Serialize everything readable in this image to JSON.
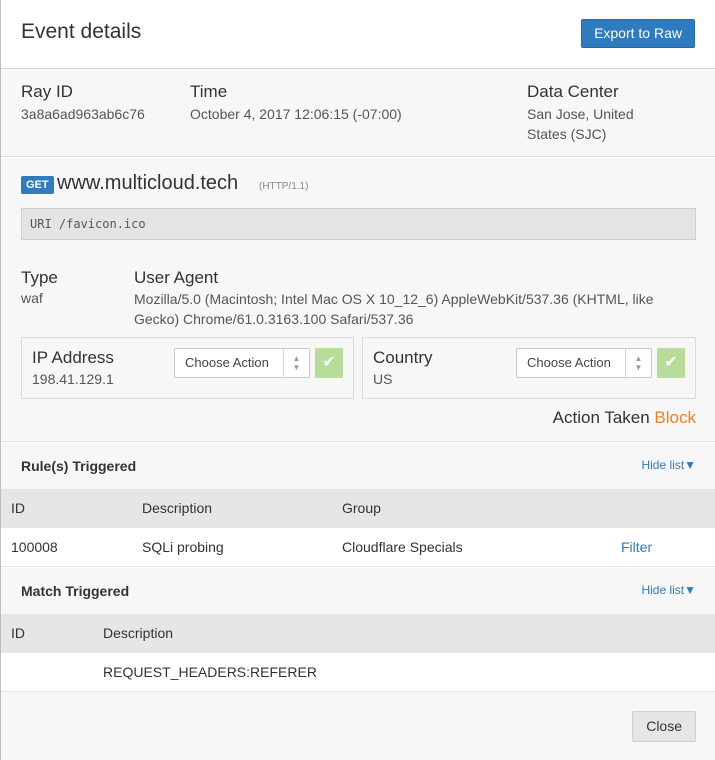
{
  "header": {
    "title": "Event details",
    "export_label": "Export to Raw"
  },
  "summary": {
    "ray_id_label": "Ray ID",
    "ray_id": "3a8a6ad963ab6c76",
    "time_label": "Time",
    "time": "October 4, 2017 12:06:15 (-07:00)",
    "dc_label": "Data Center",
    "dc_line1": "San Jose, United",
    "dc_line2": "States (SJC)"
  },
  "request": {
    "method": "GET",
    "host": "www.multicloud.tech",
    "protocol": "(HTTP/1.1)",
    "uri": "URI /favicon.ico",
    "type_label": "Type",
    "type": "waf",
    "ua_label": "User Agent",
    "ua": "Mozilla/5.0 (Macintosh; Intel Mac OS X 10_12_6) AppleWebKit/537.36 (KHTML, like Gecko) Chrome/61.0.3163.100 Safari/537.36",
    "ip_label": "IP Address",
    "ip": "198.41.129.1",
    "country_label": "Country",
    "country": "US",
    "choose_action": "Choose Action",
    "check_glyph": "✔",
    "action_taken_label": "Action Taken",
    "action_taken": "Block"
  },
  "rules": {
    "title": "Rule(s) Triggered",
    "hide_label": "Hide list▼",
    "columns": [
      "ID",
      "Description",
      "Group"
    ],
    "rows": [
      {
        "id": "100008",
        "description": "SQLi probing",
        "group": "Cloudflare Specials",
        "action": "Filter"
      }
    ]
  },
  "matches": {
    "title": "Match Triggered",
    "hide_label": "Hide list▼",
    "columns": [
      "ID",
      "Description"
    ],
    "rows": [
      {
        "id": "",
        "description": "REQUEST_HEADERS:REFERER"
      }
    ]
  },
  "footer": {
    "close_label": "Close"
  },
  "colors": {
    "accent": "#2f7bbf",
    "block": "#f38020",
    "check": "#b8dd9b"
  }
}
